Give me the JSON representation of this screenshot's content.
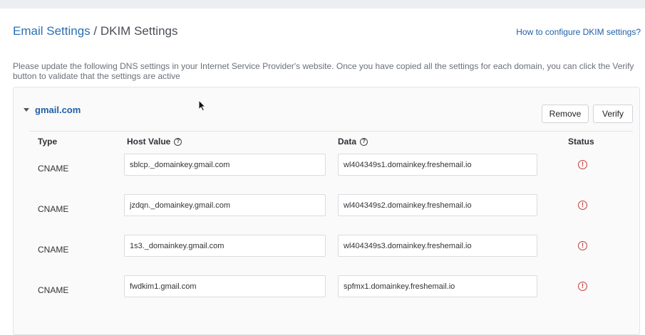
{
  "breadcrumb": {
    "parent": "Email Settings",
    "separator": " / ",
    "current": "DKIM Settings"
  },
  "help_link": "How to configure DKIM settings?",
  "intro_text": "Please update the following DNS settings in your Internet Service Provider's website. Once you have copied all the settings for each domain, you can click the Verify button to validate that the settings are active",
  "domain": {
    "name": "gmail.com",
    "remove_label": "Remove",
    "verify_label": "Verify"
  },
  "table": {
    "headers": {
      "type": "Type",
      "host": "Host Value",
      "data": "Data",
      "status": "Status"
    },
    "rows": [
      {
        "type": "CNAME",
        "host": "sblcp._domainkey.gmail.com",
        "data": "wl404349s1.domainkey.freshemail.io",
        "status": "error"
      },
      {
        "type": "CNAME",
        "host": "jzdqn._domainkey.gmail.com",
        "data": "wl404349s2.domainkey.freshemail.io",
        "status": "error"
      },
      {
        "type": "CNAME",
        "host": "1s3._domainkey.gmail.com",
        "data": "wl404349s3.domainkey.freshemail.io",
        "status": "error"
      },
      {
        "type": "CNAME",
        "host": "fwdkim1.gmail.com",
        "data": "spfmx1.domainkey.freshemail.io",
        "status": "error"
      }
    ]
  },
  "colors": {
    "link": "#1f5fa8",
    "error": "#c43b3b"
  },
  "icons": {
    "caret": "caret-down-icon",
    "help": "question-circle-icon",
    "status": "exclamation-circle-icon"
  }
}
